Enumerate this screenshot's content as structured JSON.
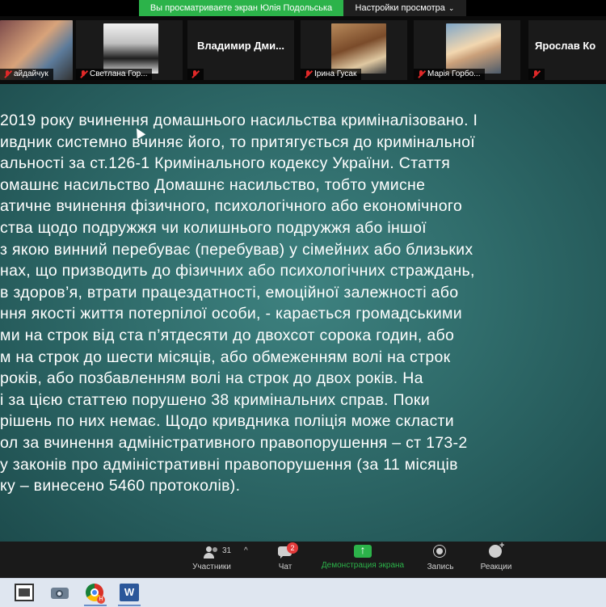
{
  "banner": {
    "sharing_text": "Вы просматриваете экран Юлія Подольська",
    "view_settings_label": "Настройки просмотра"
  },
  "participants": [
    {
      "name": "айдайчук",
      "muted": true,
      "has_video": true
    },
    {
      "name": "Светлана Гор...",
      "muted": true,
      "has_video": true
    },
    {
      "name": "Владимир Дми...",
      "muted": true,
      "has_video": false
    },
    {
      "name": "Ірина Гусак",
      "muted": true,
      "has_video": true
    },
    {
      "name": "Марія Горбо...",
      "muted": true,
      "has_video": true
    },
    {
      "name": "Ярослав Ко",
      "muted": true,
      "has_video": false
    }
  ],
  "slide": {
    "lines": [
      "2019 року вчинення домашнього насильства криміналізовано. І",
      "ивдник системно вчиняє його, то притягується до кримінальної",
      "альності за ст.126-1 Кримінального кодексу України. Стаття",
      "омашнє насильство Домашнє насильство, тобто умисне",
      "атичне вчинення фізичного, психологічного або економічного",
      "ства щодо подружжя чи колишнього подружжя або іншої",
      "з якою винний перебуває (перебував) у сімейних або близьких",
      "нах, що призводить до фізичних або психологічних страждань,",
      "в здоров’я, втрати працездатності, емоційної залежності або",
      "ння якості життя потерпілої особи, - карається громадськими",
      "ми на строк від ста п’ятдесяти до двохсот сорока годин, або",
      "м на строк до шести місяців, або обмеженням волі на строк",
      "років, або позбавленням волі на строк до двох років. На",
      "і за цією статтею порушено 38 кримінальних справ. Поки",
      "рішень по них немає. Щодо кривдника поліція може скласти",
      "ол за вчинення адміністративного правопорушення – ст 173-2",
      "у законів про адміністративні правопорушення (за 11 місяців",
      "ку – винесено 5460 протоколів)."
    ]
  },
  "toolbar": {
    "participants_label": "Участники",
    "participants_count": "31",
    "chat_label": "Чат",
    "chat_badge": "2",
    "share_label": "Демонстрация экрана",
    "record_label": "Запись",
    "reactions_label": "Реакции"
  },
  "taskbar": {
    "word_letter": "W",
    "chrome_badge": "H"
  },
  "colors": {
    "share_green": "#2cb34a",
    "slide_bg": "#2f6b6a",
    "badge_red": "#e23a3a"
  }
}
